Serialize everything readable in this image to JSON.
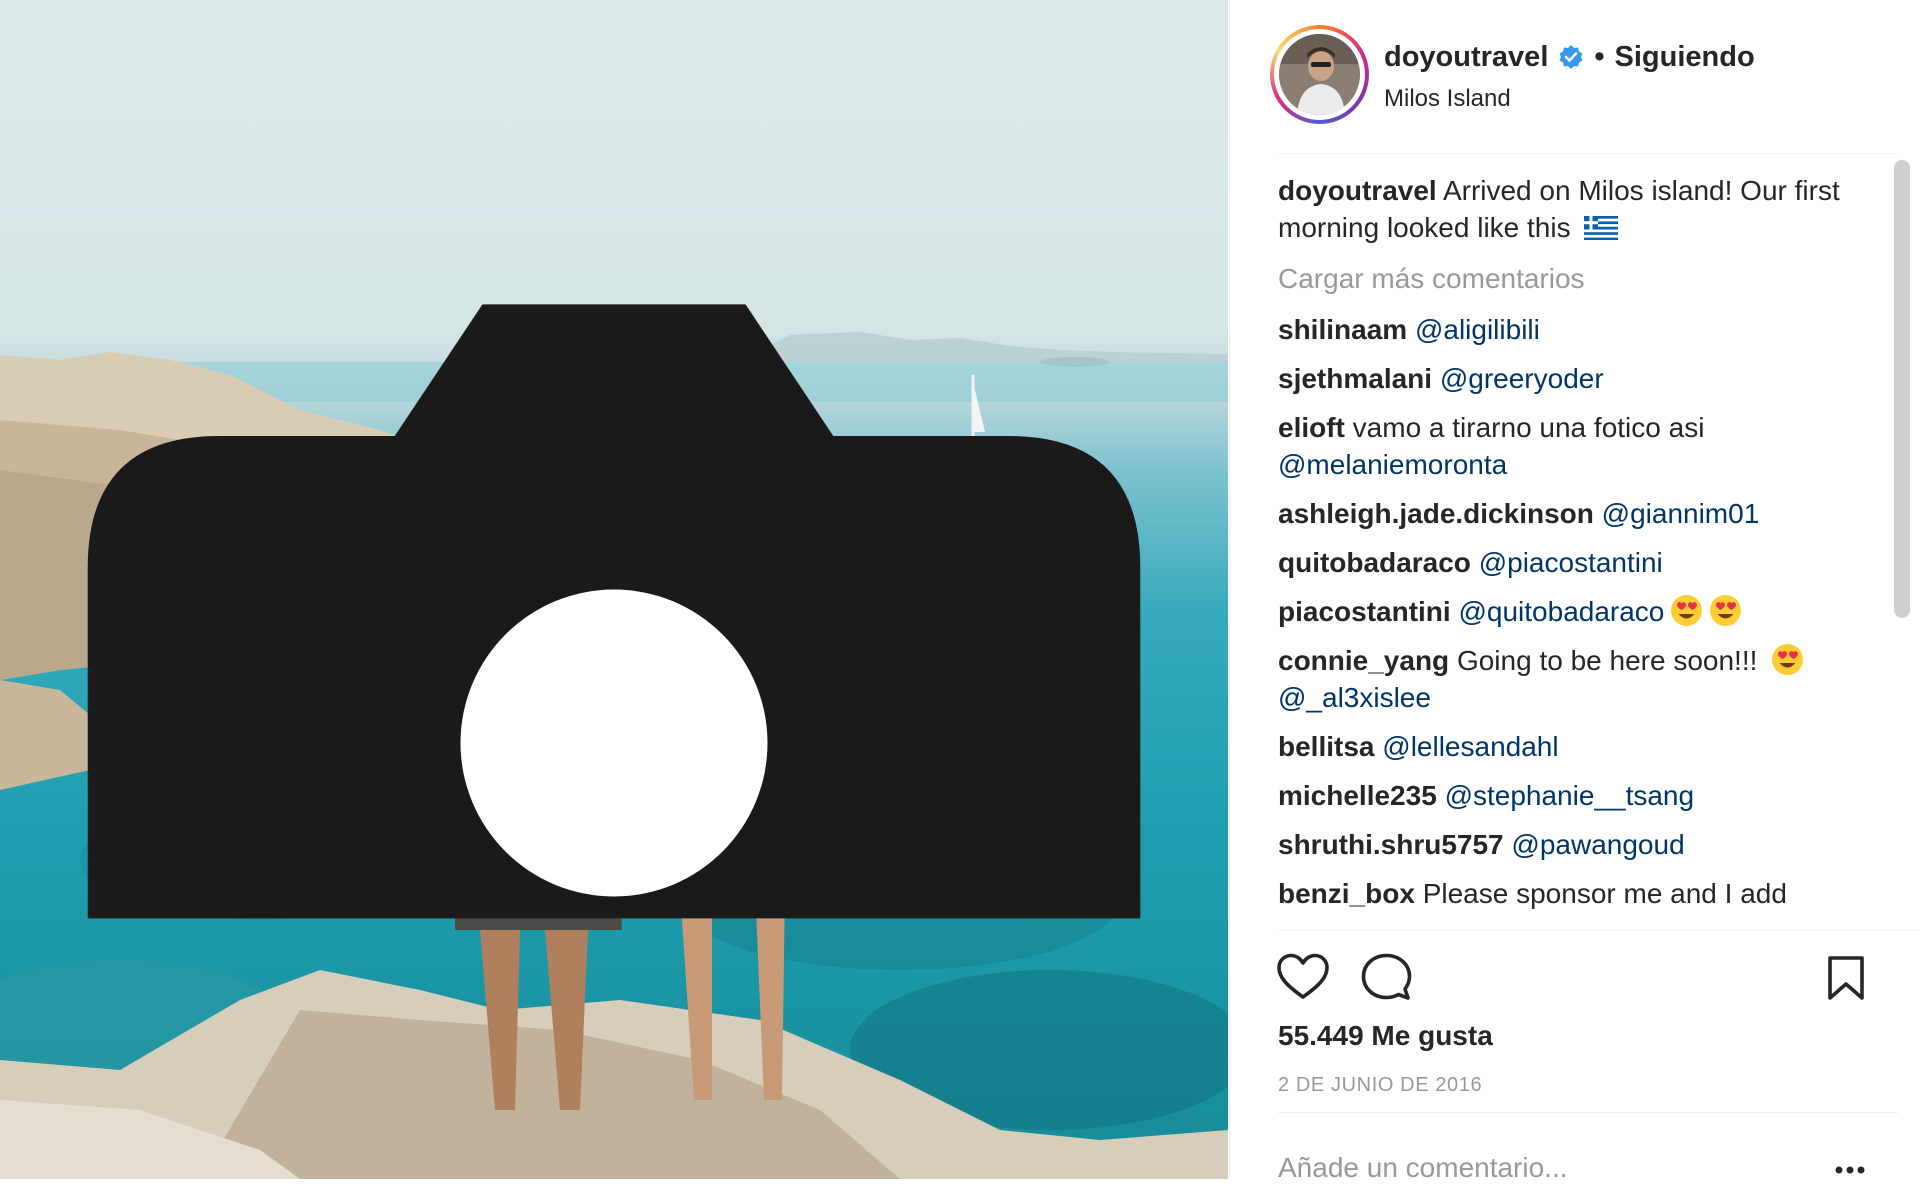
{
  "post": {
    "image_description_alt": "",
    "account": {
      "username": "doyoutravel",
      "separator": "•",
      "follow_status": "Siguiendo",
      "location": "Milos Island"
    },
    "caption": {
      "username": "doyoutravel",
      "text": "Arrived on Milos island! Our first morning looked like this"
    },
    "load_more_label": "Cargar más comentarios",
    "comments": [
      {
        "username": "shilinaam",
        "text": "",
        "mention": "@aligilibili",
        "emoji_before": 0,
        "emoji_after": 0
      },
      {
        "username": "sjethmalani",
        "text": "",
        "mention": "@greeryoder",
        "emoji_before": 0,
        "emoji_after": 0
      },
      {
        "username": "elioft",
        "text": "vamo a tirarno una fotico asi",
        "mention": "@melaniemoronta",
        "emoji_before": 0,
        "emoji_after": 0
      },
      {
        "username": "ashleigh.jade.dickinson",
        "text": "",
        "mention": "@giannim01",
        "emoji_before": 0,
        "emoji_after": 0
      },
      {
        "username": "quitobadaraco",
        "text": "",
        "mention": "@piacostantini",
        "emoji_before": 0,
        "emoji_after": 0
      },
      {
        "username": "piacostantini",
        "text": "",
        "mention": "@quitobadaraco",
        "emoji_before": 0,
        "emoji_after": 2
      },
      {
        "username": "connie_yang",
        "text": "Going to be here soon!!!",
        "mention": "@_al3xislee",
        "emoji_before": 1,
        "emoji_after": 0
      },
      {
        "username": "bellitsa",
        "text": "",
        "mention": "@lellesandahl",
        "emoji_before": 0,
        "emoji_after": 0
      },
      {
        "username": "michelle235",
        "text": "",
        "mention": "@stephanie__tsang",
        "emoji_before": 0,
        "emoji_after": 0
      },
      {
        "username": "shruthi.shru5757",
        "text": "",
        "mention": "@pawangoud",
        "emoji_before": 0,
        "emoji_after": 0
      },
      {
        "username": "benzi_box",
        "text": "Please sponsor me and I add",
        "mention": "",
        "emoji_before": 0,
        "emoji_after": 0
      }
    ],
    "likes_label": "55.449 Me gusta",
    "date_label": "2 DE JUNIO DE 2016",
    "add_comment_placeholder": "Añade un comentario..."
  },
  "icons": {
    "verified": "verified-badge-icon",
    "flag": "greece-flag-emoji",
    "emoji": "heart-eyes-emoji",
    "like": "heart-outline-icon",
    "comment": "comment-bubble-icon",
    "save": "bookmark-icon",
    "more": "more-options-icon",
    "photo_corner": "camera-icon"
  },
  "colors": {
    "text": "#262626",
    "mention": "#003569",
    "muted": "#999999",
    "verified": "#3897f0",
    "sea": "#1e9fb0"
  }
}
